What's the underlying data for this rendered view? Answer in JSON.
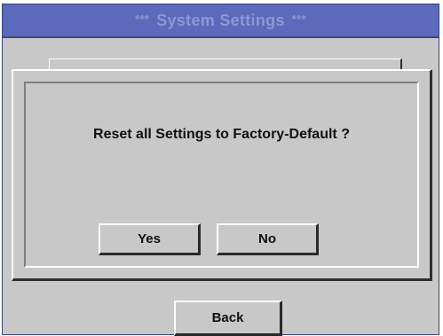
{
  "header": {
    "title": "System Settings",
    "left_decoration": "***",
    "right_decoration": "***"
  },
  "dialog": {
    "message": "Reset all Settings to Factory-Default ?",
    "yes_label": "Yes",
    "no_label": "No"
  },
  "footer": {
    "back_label": "Back"
  },
  "colors": {
    "title_bar": "#5b6aba",
    "title_text": "#8d97d4",
    "panel": "#c8c8c8"
  }
}
